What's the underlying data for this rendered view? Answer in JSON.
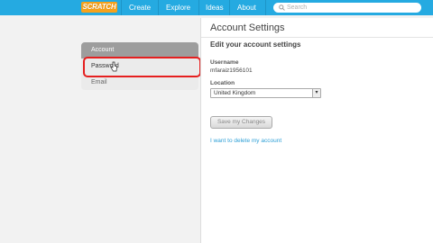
{
  "topbar": {
    "logo": "SCRATCH",
    "nav": [
      "Create",
      "Explore",
      "Ideas",
      "About"
    ],
    "search_placeholder": "Search"
  },
  "sidebar": {
    "items": [
      {
        "label": "Account",
        "active": true
      },
      {
        "label": "Password",
        "active": false
      },
      {
        "label": "Email",
        "active": false
      }
    ]
  },
  "panel": {
    "title": "Account Settings",
    "subtitle": "Edit your account settings",
    "username_label": "Username",
    "username_value": "mfaraiz1956101",
    "location_label": "Location",
    "location_value": "United Kingdom",
    "save_label": "Save my Changes",
    "delete_link": "I want to delete my account"
  },
  "colors": {
    "topbar": "#25aae1",
    "logo": "#f7a21b",
    "active_menu": "#9d9d9d",
    "highlight": "#e51f1f",
    "link": "#2d9fd6"
  }
}
